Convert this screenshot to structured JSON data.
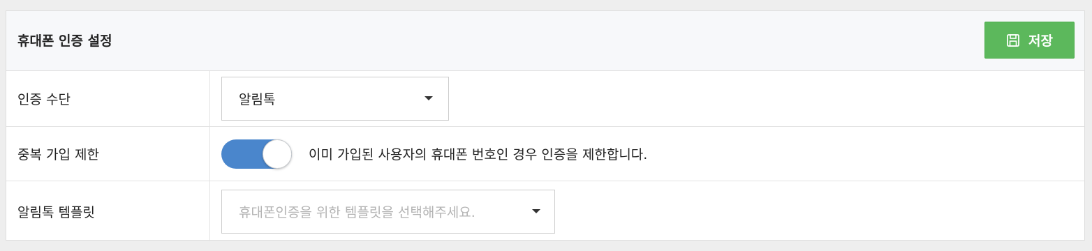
{
  "panel": {
    "title": "휴대폰 인증 설정",
    "save_label": "저장",
    "save_color": "#5cb85c"
  },
  "rows": [
    {
      "label": "인증 수단",
      "select_value": "알림톡"
    },
    {
      "label": "중복 가입 제한",
      "toggle_on": true,
      "toggle_color": "#4a86cc",
      "description": "이미 가입된 사용자의 휴대폰 번호인 경우 인증을 제한합니다."
    },
    {
      "label": "알림톡 템플릿",
      "select_placeholder": "휴대폰인증을 위한 템플릿을 선택해주세요."
    }
  ],
  "icons": {
    "save": "floppy-disk-icon",
    "dropdown": "caret-down-icon"
  }
}
